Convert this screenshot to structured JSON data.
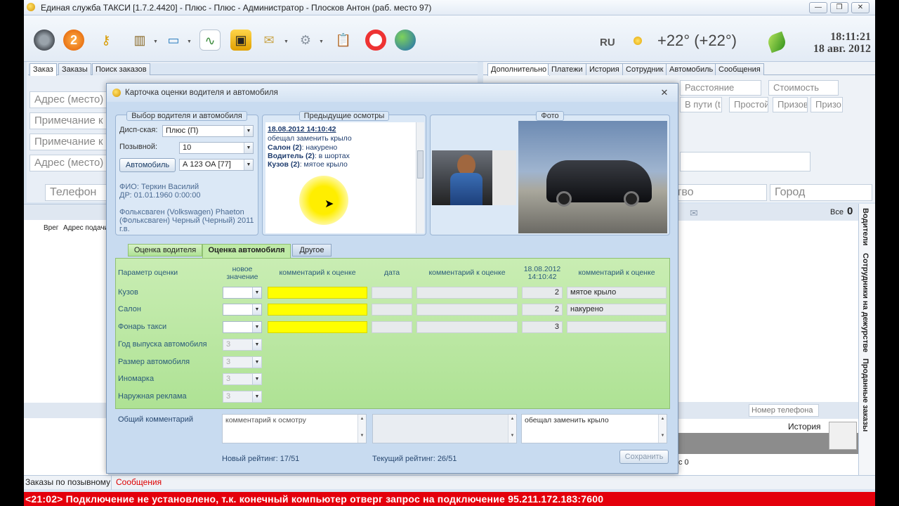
{
  "window": {
    "title": "Единая служба ТАКСИ [1.7.2.4420] - Плюс - Плюс  - Администратор - Плосков Антон (раб. место 97)",
    "minimize": "—",
    "maximize": "❐",
    "close": "✕"
  },
  "toolbar": {
    "icons": [
      "tire-icon",
      "support-icon",
      "key-icon",
      "book-icon",
      "monitor-icon",
      "chart-icon",
      "taxi-icon",
      "mail-icon",
      "gear-icon",
      "clipboard-icon",
      "lifebuoy-icon",
      "globe-icon"
    ],
    "lang": "RU",
    "temperature": "+22° (+22°)",
    "time": "18:11:21",
    "date": "18 авг. 2012"
  },
  "left_panel": {
    "tabs": [
      "Заказ",
      "Заказы",
      "Поиск заказов"
    ],
    "fields": [
      "Адрес (место)",
      "Примечание к",
      "Примечание к",
      "Адрес (место)"
    ],
    "phone_placeholder": "Телефон",
    "list_headers": [
      "Врег",
      "Адрес подачи"
    ]
  },
  "right_panel": {
    "tabs": [
      "Дополнительно",
      "Платежи",
      "История",
      "Сотрудник",
      "Автомобиль",
      "Сообщения"
    ],
    "fields": [
      "Расстояние",
      "Стоимость",
      "В пути (t",
      "Простой",
      "Призов",
      "Призо"
    ],
    "fragment": "тво",
    "city_placeholder": "Город",
    "all_label": "Все",
    "all_count": "0",
    "vertical_tabs": [
      "Водители",
      "Сотрудники на дежурстве",
      "Проданные заказы"
    ],
    "phone_search": "Номер телефона",
    "history": "История",
    "count_label": "с 0"
  },
  "bottom_tabs": [
    "Заказы по позывному",
    "Сообщения"
  ],
  "status_bar": "<21:02> Подключение не установлено, т.к. конечный компьютер отверг запрос на подключение 95.211.172.183:7600",
  "dialog": {
    "title": "Карточка оценки водителя и автомобиля",
    "selection": {
      "caption": "Выбор водителя и автомобиля",
      "dispatch_label": "Дисп-ская:",
      "dispatch_value": "Плюс  (П)",
      "callsign_label": "Позывной:",
      "callsign_value": "10",
      "car_button": "Автомобиль",
      "car_value": "А 123 ОА [77]",
      "fio": "ФИО: Теркин Василий",
      "dob": "ДР: 01.01.1960 0:00:00",
      "car_desc_1": "Фольксваген (Volkswagen) Phaeton",
      "car_desc_2": "(Фольксваген) Черный (Черный) 2011",
      "car_desc_3": "г.в."
    },
    "previous": {
      "caption": "Предыдущие осмотры",
      "date": "18.08.2012 14:10:42",
      "line1": "обещал заменить крыло",
      "items": [
        {
          "k": "Салон (2)",
          "v": ": накурено"
        },
        {
          "k": "Водитель (2)",
          "v": ": в шортах"
        },
        {
          "k": "Кузов (2)",
          "v": ": мятое крыло"
        }
      ]
    },
    "photo": {
      "caption": "Фото"
    },
    "eval_tabs": [
      "Оценка водителя",
      "Оценка автомобиля",
      "Другое"
    ],
    "grid": {
      "headers": {
        "param": "Параметр оценки",
        "new_value": "новое значение",
        "comment": "комментарий к оценке",
        "date": "дата",
        "comment2": "комментарий к оценке",
        "prev_date": "18.08.2012 14:10:42",
        "comment3": "комментарий к оценке"
      },
      "rows": [
        {
          "param": "Кузов",
          "prev": "2",
          "prev_comment": "мятое крыло"
        },
        {
          "param": "Салон",
          "prev": "2",
          "prev_comment": "накурено"
        },
        {
          "param": "Фонарь такси",
          "prev": "3",
          "prev_comment": ""
        }
      ],
      "disabled_rows": [
        {
          "param": "Год выпуска автомобиля",
          "value": "3"
        },
        {
          "param": "Размер автомобиля",
          "value": "3"
        },
        {
          "param": "Иномарка",
          "value": "3"
        },
        {
          "param": "Наружная реклама",
          "value": "3"
        }
      ]
    },
    "general_comment_label": "Общий комментарий",
    "comment_placeholder": "комментарий к осмотру",
    "prev_comment": "обещал заменить крыло",
    "new_rating": "Новый рейтинг: 17/51",
    "current_rating": "Текущий рейтинг: 26/51",
    "save": "Сохранить"
  }
}
